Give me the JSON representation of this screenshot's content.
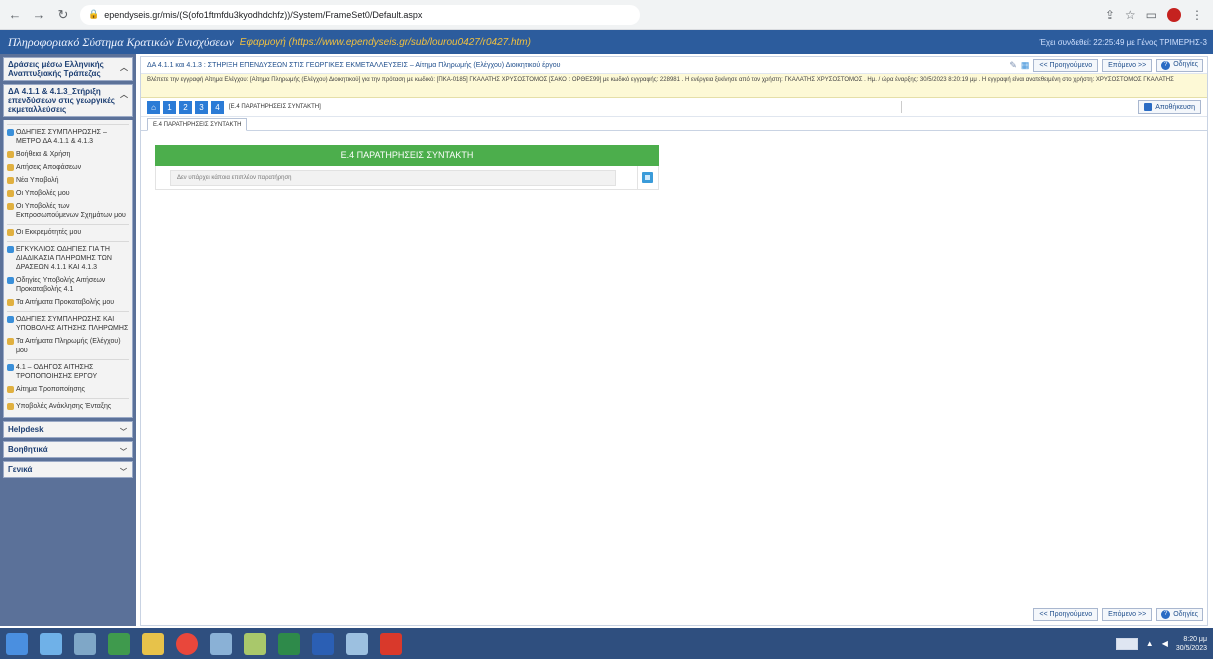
{
  "browser": {
    "url": "ependyseis.gr/mis/(S(ofo1ftmfdu3kyodhdchfz))/System/FrameSet0/Default.aspx"
  },
  "header": {
    "title": "Πληροφοριακό Σύστημα Κρατικών Ενισχύσεων",
    "link": "Εφαρμογή (https://www.ependyseis.gr/sub/lourou0427/r0427.htm)",
    "user_info": "Έχει συνδεθεί: 22:25:49 με Γένος ΤΡΙΜΕΡΗΣ-3"
  },
  "sidebar": {
    "panel_title": "Δράσεις μέσω Ελληνικής Αναπτυξιακής Τράπεζας",
    "panel_subtitle": "ΔΑ 4.1.1 & 4.1.3_Στήριξη επενδύσεων στις γεωργικές εκμεταλλεύσεις",
    "items": [
      {
        "label": "ΟΔΗΓΙΕΣ ΣΥΜΠΛΗΡΩΣΗΣ – ΜΕΤΡΟ ΔΑ 4.1.1 & 4.1.3",
        "group": true,
        "color": "#3a8fd9"
      },
      {
        "label": "Βοήθεια & Χρήση",
        "group": false,
        "color": "#e0b040"
      },
      {
        "label": "Αιτήσεις Αποφάσεων",
        "group": false,
        "color": "#e0b040"
      },
      {
        "label": "Νέα Υποβολή",
        "group": false,
        "color": "#e0b040"
      },
      {
        "label": "Οι Υποβολές μου",
        "group": false,
        "color": "#e0b040"
      },
      {
        "label": "Οι Υποβολές των Εκπροσωπούμενων Σχημάτων μου",
        "group": false,
        "color": "#e0b040"
      },
      {
        "label": "Οι Εκκρεμότητές μου",
        "group": true,
        "color": "#e0b040"
      },
      {
        "label": "ΕΓΚΥΚΛΙΟΣ ΟΔΗΓΙΕΣ ΓΙΑ ΤΗ ΔΙΑΔΙΚΑΣΙΑ ΠΛΗΡΩΜΗΣ ΤΩΝ ΔΡΑΣΕΩΝ 4.1.1 ΚΑΙ 4.1.3",
        "group": true,
        "color": "#3a8fd9"
      },
      {
        "label": "Οδηγίες Υποβολής Αιτήσεων Προκαταβολής 4.1",
        "group": false,
        "color": "#3a8fd9"
      },
      {
        "label": "Τα Αιτήματα Προκαταβολής μου",
        "group": false,
        "color": "#e0b040"
      },
      {
        "label": "ΟΔΗΓΙΕΣ ΣΥΜΠΛΗΡΩΣΗΣ ΚΑΙ ΥΠΟΒΟΛΗΣ ΑΙΤΗΣΗΣ ΠΛΗΡΩΜΗΣ",
        "group": true,
        "color": "#3a8fd9"
      },
      {
        "label": "Τα Αιτήματα Πληρωμής (Ελέγχου) μου",
        "group": false,
        "color": "#e0b040"
      },
      {
        "label": "4.1 – ΟΔΗΓΟΣ ΑΙΤΗΣΗΣ ΤΡΟΠΟΠΟΙΗΣΗΣ ΕΡΓΟΥ",
        "group": true,
        "color": "#3a8fd9"
      },
      {
        "label": "Αίτημα Τροποποίησης",
        "group": false,
        "color": "#e0b040"
      },
      {
        "label": "Υποβολές Ανάκλησης Ένταξης",
        "group": true,
        "color": "#e0b040"
      }
    ],
    "collapsed": [
      "Helpdesk",
      "Βοηθητικά",
      "Γενικά"
    ]
  },
  "main": {
    "breadcrumb": "ΔΑ 4.1.1 και 4.1.3 : ΣΤΗΡΙΞΗ ΕΠΕΝΔΥΣΕΩΝ ΣΤΙΣ ΓΕΩΡΓΙΚΕΣ ΕΚΜΕΤΑΛΛΕΥΣΕΙΣ – Αίτημα Πληρωμής (Ελέγχου) Διοικητικού έργου",
    "prev_label": "<< Προηγούμενο",
    "next_label": "Επόμενο >>",
    "help_label": "Οδηγίες",
    "info_text": "Βλέπετε την εγγραφή Αίτημα Ελέγχου: [Αίτημα Πληρωμής (Ελέγχου) Διοικητικού] για την πρόταση με κωδικό: [ΠΚΑ-0185] ΓΚΑΛΑΤΗΣ ΧΡΥΣΟΣΤΟΜΟΣ [ΣΑΚΟ : ΟΡΘΕΣ99] με κωδικό εγγραφής: 228981 . Η ενέργεια ξεκίνησε από τον χρήστη: ΓΚΑΛΑΤΗΣ ΧΡΥΣΟΣΤΟΜΟΣ . Ημ. / ώρα έναρξης: 30/5/2023 8:20:19 μμ . Η εγγραφή είναι ανατεθειμένη στο χρήστη: ΧΡΥΣΟΣΤΟΜΟΣ ΓΚΑΛΑΤΗΣ",
    "steps": [
      "1",
      "2",
      "3",
      "4"
    ],
    "step_label": "[Ε.4 ΠΑΡΑΤΗΡΗΣΕΙΣ ΣΥΝΤΑΚΤΗ]",
    "save_label": "Αποθήκευση",
    "tab_label": "Ε.4 ΠΑΡΑΤΗΡΗΣΕΙΣ ΣΥΝΤΑΚΤΗ",
    "section_title": "Ε.4 ΠΑΡΑΤΗΡΗΣΕΙΣ ΣΥΝΤΑΚΤΗ",
    "comment_placeholder": "Δεν υπάρχει κάποια επιπλέον παρατήρηση"
  },
  "tray": {
    "time": "8:20 μμ",
    "date": "30/5/2023"
  },
  "colors": {
    "header_bg": "#2c5c9d",
    "sidebar_bg": "#5b7199",
    "section_green": "#4cae4c",
    "taskbar": "#2f4f7f"
  }
}
